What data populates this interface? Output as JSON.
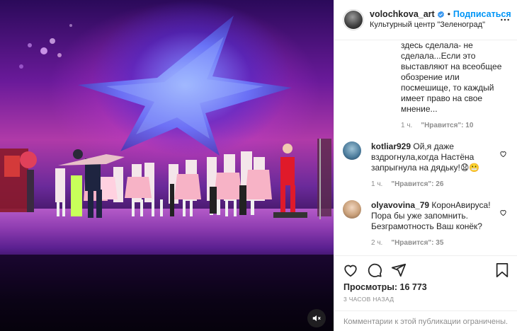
{
  "media": {
    "mute_icon": "speaker-muted-icon"
  },
  "header": {
    "username": "volochkova_art",
    "verified_icon": "verified-badge-icon",
    "separator": "•",
    "follow_label": "Подписаться",
    "location": "Культурный центр \"Зеленоград\"",
    "more_icon": "more-horizontal-icon"
  },
  "comments": {
    "continued": {
      "text": "здесь сделала- не сделала...Если это выставляют на всеобщее обозрение или посмешище, то каждый имеет право на свое мнение...",
      "time": "1 ч.",
      "likes": "\"Нравится\": 10"
    },
    "items": [
      {
        "username": "kotliar929",
        "text": "Ой,я даже вздрогнула,когда Настёна запрыгнула на дядьку!😧😬",
        "time": "1 ч.",
        "likes": "\"Нравится\": 26",
        "avatar_color": "#4a7a9a"
      },
      {
        "username": "olyavovina_79",
        "text": "КоронАвируса! Пора бы уже запомнить. Безграмотность Ваш конёк?",
        "time": "2 ч.",
        "likes": "\"Нравится\": 35",
        "avatar_color": "#c9a07a"
      }
    ]
  },
  "actions": {
    "like_icon": "heart-icon",
    "comment_icon": "comment-icon",
    "share_icon": "share-plane-icon",
    "save_icon": "bookmark-icon",
    "views_label": "Просмотры:",
    "views_count": "16 773",
    "time_ago": "3 ЧАСОВ НАЗАД",
    "comments_restricted": "Комментарии к этой публикации ограничены."
  },
  "colors": {
    "accent": "#0095f6",
    "secondary_text": "#8e8e8e",
    "border": "#efefef"
  }
}
